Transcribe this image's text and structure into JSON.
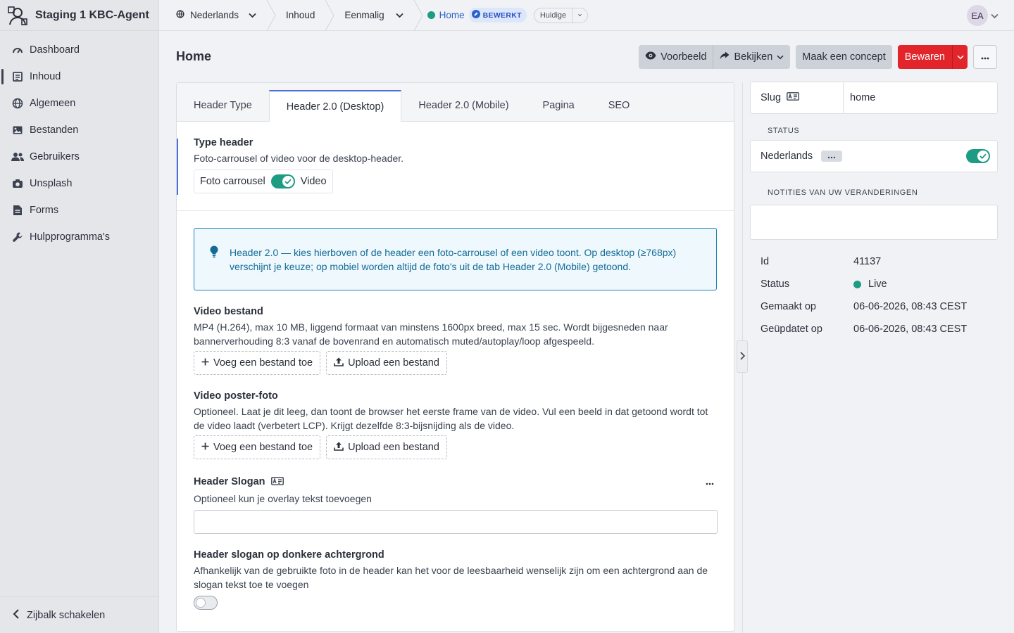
{
  "brand": {
    "name": "Staging 1 KBC-Agent"
  },
  "sidebar": {
    "items": [
      {
        "label": "Dashboard",
        "icon": "gauge-icon"
      },
      {
        "label": "Inhoud",
        "icon": "newspaper-icon",
        "active": true
      },
      {
        "label": "Algemeen",
        "icon": "globe-icon"
      },
      {
        "label": "Bestanden",
        "icon": "image-icon"
      },
      {
        "label": "Gebruikers",
        "icon": "users-icon"
      },
      {
        "label": "Unsplash",
        "icon": "camera-icon"
      },
      {
        "label": "Forms",
        "icon": "file-icon"
      },
      {
        "label": "Hulpprogramma's",
        "icon": "wrench-icon"
      }
    ],
    "footer_label": "Zijbalk schakelen"
  },
  "topbar": {
    "language": "Nederlands",
    "crumb_content": "Inhoud",
    "crumb_type": "Eenmalig",
    "page": "Home",
    "status_badge": "BEWERKT",
    "version": "Huidige",
    "avatar_initials": "EA"
  },
  "page": {
    "title": "Home"
  },
  "actions": {
    "preview": "Voorbeeld",
    "view": "Bekijken",
    "draft": "Maak een concept",
    "save": "Bewaren"
  },
  "tabs": [
    {
      "label": "Header Type"
    },
    {
      "label": "Header 2.0 (Desktop)",
      "active": true
    },
    {
      "label": "Header 2.0 (Mobile)"
    },
    {
      "label": "Pagina"
    },
    {
      "label": "SEO"
    }
  ],
  "type_header": {
    "label": "Type header",
    "help": "Foto-carrousel of video voor de desktop-header.",
    "option_left": "Foto carrousel",
    "option_right": "Video",
    "is_video": true
  },
  "info": {
    "text": "Header 2.0 — kies hierboven of de header een foto-carrousel of een video toont. Op desktop (≥768px) verschijnt je keuze; op mobiel worden altijd de foto's uit de tab Header 2.0 (Mobile) getoond."
  },
  "video_file": {
    "label": "Video bestand",
    "help": "MP4 (H.264), max 10 MB, liggend formaat van minstens 1600px breed, max 15 sec. Wordt bijgesneden naar bannerverhouding 8:3 vanaf de bovenrand en automatisch muted/autoplay/loop afgespeeld.",
    "add": "Voeg een bestand toe",
    "upload": "Upload een bestand"
  },
  "poster": {
    "label": "Video poster-foto",
    "help": "Optioneel. Laat je dit leeg, dan toont de browser het eerste frame van de video. Vul een beeld in dat getoond wordt tot de video laadt (verbetert LCP). Krijgt dezelfde 8:3-bijsnijding als de video.",
    "add": "Voeg een bestand toe",
    "upload": "Upload een bestand"
  },
  "slogan": {
    "label": "Header Slogan",
    "help": "Optioneel kun je overlay tekst toevoegen",
    "value": ""
  },
  "slogan_dark": {
    "label": "Header slogan op donkere achtergrond",
    "help": "Afhankelijk van de gebruikte foto in de header kan het voor de leesbaarheid wenselijk zijn om een achtergrond aan de slogan tekst toe te voegen",
    "enabled": false
  },
  "right": {
    "slug_label": "Slug",
    "slug_value": "home",
    "status_heading": "STATUS",
    "language": "Nederlands",
    "language_enabled": true,
    "notes_heading": "NOTITIES VAN UW VERANDERINGEN",
    "meta": [
      {
        "key": "Id",
        "value": "41137"
      },
      {
        "key": "Status",
        "value": "Live"
      },
      {
        "key": "Gemaakt op",
        "value": "06-06-2026, 08:43 CEST"
      },
      {
        "key": "Geüpdatet op",
        "value": "06-06-2026, 08:43 CEST"
      }
    ]
  },
  "colors": {
    "accent": "#1d9b83",
    "save": "#e1252a",
    "info": "#1f86b6",
    "tab_active": "#4a6fd8"
  }
}
